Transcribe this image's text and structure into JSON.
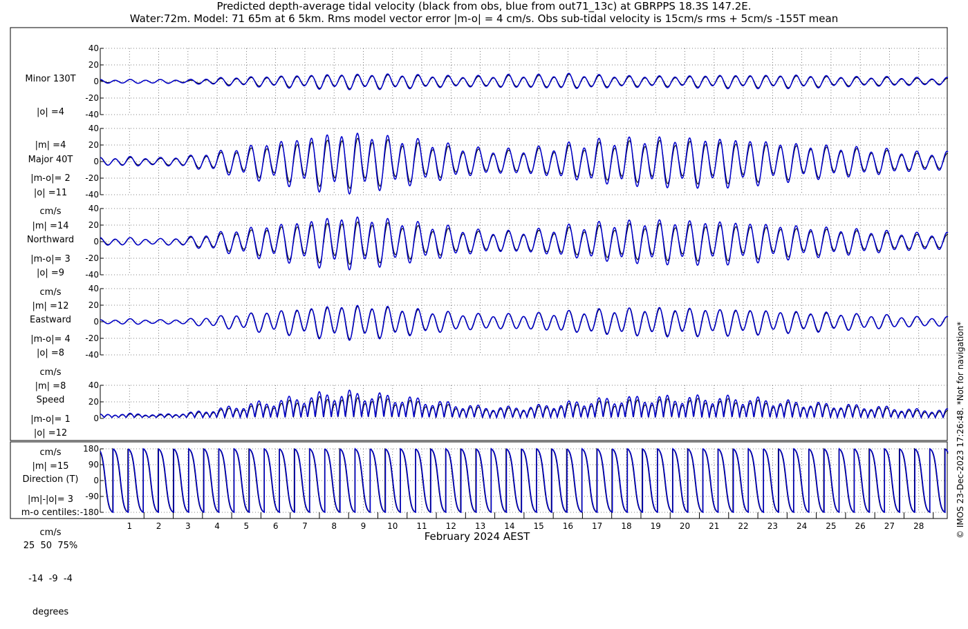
{
  "title_line1": "Predicted depth-average tidal velocity (black from obs, blue from out71_13c) at GBRPPS 18.3S 147.2E.",
  "title_line2": "Water:72m. Model: 71 65m at 6 5km. Rms model vector error |m-o| = 4 cm/s. Obs sub-tidal velocity is 15cm/s rms + 5cm/s -155T mean",
  "xlabel": "February 2024 AEST",
  "credit": "© IMOS 23-Dec-2023 17:26:48. *Not for navigation*",
  "colors": {
    "obs": "#000000",
    "model": "#0000cc",
    "grid": "#555555"
  },
  "panel_labels": {
    "minor": [
      "Minor 130T",
      "|o| =4",
      "|m| =4",
      "|m-o|= 2",
      "cm/s"
    ],
    "major": [
      "Major 40T",
      "|o| =11",
      "|m| =14",
      "|m-o|= 3",
      "cm/s"
    ],
    "north": [
      "Northward",
      "|o| =9",
      "|m| =12",
      "|m-o|= 4",
      "cm/s"
    ],
    "east": [
      "Eastward",
      "|o| =8",
      "|m| =8",
      "|m-o|= 1",
      "cm/s"
    ],
    "speed": [
      "Speed",
      "|o| =12",
      "|m| =15",
      "|m|-|o|= 3",
      "cm/s"
    ],
    "direction": [
      "Direction (T)",
      "m-o centiles:",
      "25  50  75%",
      "-14  -9  -4",
      "degrees"
    ]
  },
  "chart_data": [
    {
      "type": "line",
      "name": "Minor 130T",
      "x_day_ticks": [
        "1",
        "2",
        "3",
        "4",
        "5",
        "6",
        "7",
        "8",
        "9",
        "10",
        "11",
        "12",
        "13",
        "14",
        "15",
        "16",
        "17",
        "18",
        "19",
        "20",
        "21",
        "22",
        "23",
        "24",
        "25",
        "26",
        "27",
        "28"
      ],
      "xlim_days": [
        0,
        29
      ],
      "ylim": [
        -40,
        40
      ],
      "yticks": [
        -40,
        -20,
        0,
        20,
        40
      ],
      "grid": true,
      "series": [
        {
          "name": "obs",
          "peak_amplitude_by_day": [
            1,
            2,
            2,
            1,
            3,
            4,
            5,
            6,
            7,
            7,
            7,
            6,
            5,
            5,
            6,
            6,
            7,
            6,
            5,
            5,
            5,
            6,
            6,
            6,
            6,
            5,
            4,
            4,
            3
          ]
        },
        {
          "name": "model",
          "peak_amplitude_by_day": [
            2,
            2,
            2,
            2,
            4,
            5,
            6,
            7,
            8,
            8,
            8,
            7,
            6,
            6,
            7,
            7,
            8,
            7,
            6,
            6,
            6,
            7,
            7,
            7,
            7,
            6,
            5,
            5,
            4
          ]
        }
      ]
    },
    {
      "type": "line",
      "name": "Major 40T",
      "ylim": [
        -40,
        40
      ],
      "yticks": [
        -40,
        -20,
        0,
        20,
        40
      ],
      "grid": true,
      "series": [
        {
          "name": "obs",
          "peak_amplitude_by_day": [
            4,
            4,
            3,
            5,
            9,
            14,
            18,
            22,
            26,
            26,
            23,
            19,
            15,
            12,
            11,
            13,
            16,
            19,
            21,
            22,
            22,
            22,
            21,
            19,
            17,
            15,
            13,
            11,
            8
          ]
        },
        {
          "name": "model",
          "peak_amplitude_by_day": [
            4,
            5,
            4,
            6,
            11,
            17,
            22,
            27,
            32,
            31,
            27,
            23,
            18,
            14,
            13,
            15,
            19,
            23,
            25,
            26,
            26,
            26,
            25,
            22,
            19,
            17,
            15,
            13,
            10
          ]
        }
      ]
    },
    {
      "type": "line",
      "name": "Northward",
      "ylim": [
        -40,
        40
      ],
      "yticks": [
        -40,
        -20,
        0,
        20,
        40
      ],
      "grid": true,
      "series": [
        {
          "name": "obs",
          "peak_amplitude_by_day": [
            3,
            4,
            3,
            4,
            8,
            12,
            16,
            19,
            22,
            22,
            20,
            16,
            13,
            10,
            10,
            11,
            14,
            16,
            18,
            19,
            19,
            19,
            18,
            16,
            14,
            13,
            11,
            9,
            7
          ]
        },
        {
          "name": "model",
          "peak_amplitude_by_day": [
            4,
            4,
            3,
            5,
            10,
            15,
            19,
            23,
            28,
            27,
            24,
            20,
            16,
            12,
            11,
            13,
            17,
            20,
            22,
            23,
            23,
            23,
            22,
            19,
            17,
            15,
            13,
            11,
            9
          ]
        }
      ]
    },
    {
      "type": "line",
      "name": "Eastward",
      "ylim": [
        -40,
        40
      ],
      "yticks": [
        -40,
        -20,
        0,
        20,
        40
      ],
      "grid": true,
      "series": [
        {
          "name": "obs",
          "peak_amplitude_by_day": [
            2,
            3,
            2,
            3,
            6,
            9,
            12,
            14,
            17,
            17,
            15,
            12,
            10,
            8,
            8,
            9,
            11,
            12,
            14,
            14,
            14,
            14,
            13,
            12,
            10,
            9,
            8,
            7,
            5
          ]
        },
        {
          "name": "model",
          "peak_amplitude_by_day": [
            2,
            3,
            2,
            3,
            6,
            9,
            12,
            15,
            18,
            18,
            16,
            13,
            10,
            8,
            8,
            9,
            11,
            13,
            14,
            15,
            15,
            14,
            14,
            12,
            11,
            10,
            8,
            7,
            5
          ]
        }
      ]
    },
    {
      "type": "line",
      "name": "Speed",
      "ylim": [
        0,
        40
      ],
      "yticks": [
        0,
        20,
        40
      ],
      "grid": true,
      "series": [
        {
          "name": "obs",
          "peak_by_day": [
            4,
            4,
            3,
            5,
            9,
            14,
            18,
            22,
            26,
            26,
            23,
            19,
            15,
            12,
            11,
            13,
            16,
            19,
            21,
            22,
            22,
            22,
            21,
            19,
            17,
            15,
            13,
            11,
            8
          ]
        },
        {
          "name": "model",
          "peak_by_day": [
            4,
            5,
            4,
            6,
            11,
            17,
            22,
            27,
            32,
            31,
            27,
            23,
            18,
            14,
            13,
            15,
            19,
            23,
            25,
            26,
            26,
            26,
            25,
            22,
            19,
            17,
            15,
            13,
            10
          ]
        }
      ]
    },
    {
      "type": "line",
      "name": "Direction (T)",
      "ylim": [
        -180,
        180
      ],
      "yticks": [
        -180,
        -90,
        0,
        90,
        180
      ],
      "grid": true,
      "series": [
        {
          "name": "obs",
          "description_values": "sawtooth wrapping 180 to -180 twice daily"
        },
        {
          "name": "model",
          "description_values": "sawtooth wrapping 180 to -180 twice daily"
        }
      ]
    }
  ]
}
